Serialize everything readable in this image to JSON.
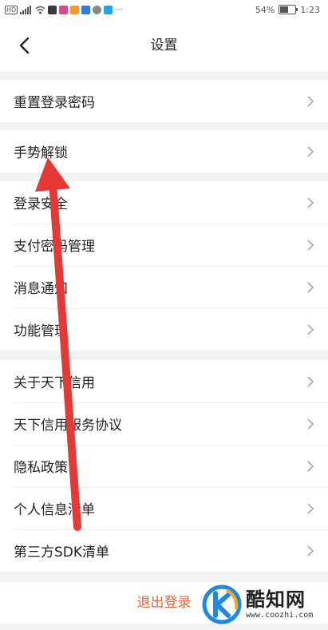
{
  "status_bar": {
    "battery_percent": "54%",
    "battery_level": 0.54,
    "time": "1:23"
  },
  "nav": {
    "title": "设置"
  },
  "groups": [
    {
      "items": [
        {
          "label": "重置登录密码"
        }
      ]
    },
    {
      "items": [
        {
          "label": "手势解锁"
        }
      ]
    },
    {
      "items": [
        {
          "label": "登录安全"
        },
        {
          "label": "支付密码管理"
        },
        {
          "label": "消息通知"
        },
        {
          "label": "功能管理"
        }
      ]
    },
    {
      "items": [
        {
          "label": "关于天下信用"
        },
        {
          "label": "天下信用服务协议"
        },
        {
          "label": "隐私政策"
        },
        {
          "label": "个人信息清单"
        },
        {
          "label": "第三方SDK清单"
        }
      ]
    }
  ],
  "logout": {
    "label": "退出登录",
    "color": "#e8663b"
  },
  "watermark": {
    "brand": "酷知网",
    "url": "www.coozhi.com"
  },
  "overlay": {
    "arrow_color": "#e53935"
  }
}
